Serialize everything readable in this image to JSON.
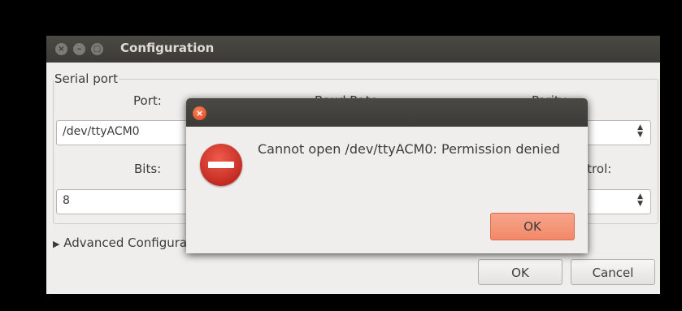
{
  "window": {
    "title": "Configuration",
    "controls": [
      "close-icon",
      "minimize-icon",
      "maximize-icon"
    ]
  },
  "serial_port": {
    "group_title": "Serial port",
    "port": {
      "label": "Port:",
      "value": "/dev/ttyACM0"
    },
    "baud_rate": {
      "label": "Baud Rate:"
    },
    "parity": {
      "label": "Parity:"
    },
    "bits": {
      "label": "Bits:",
      "value": "8"
    },
    "flow_control": {
      "label": "Flow Control:"
    }
  },
  "advanced": {
    "label": "Advanced Configuration"
  },
  "buttons": {
    "ok": "OK",
    "cancel": "Cancel"
  },
  "error_dialog": {
    "message": "Cannot open /dev/ttyACM0: Permission denied",
    "ok_label": "OK",
    "icon": "error-icon",
    "accent_color": "#f2896a"
  }
}
